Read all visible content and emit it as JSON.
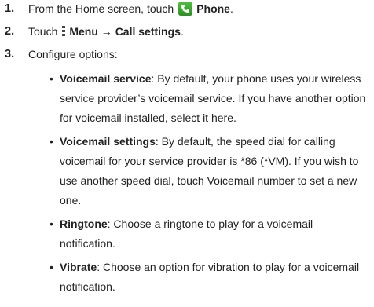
{
  "steps": [
    {
      "number": "1.",
      "before": "From the Home screen, touch",
      "bold": "Phone",
      "after": "."
    },
    {
      "number": "2.",
      "before": "Touch",
      "bold": "Menu → Call settings",
      "after": "."
    },
    {
      "number": "3.",
      "text": "Configure options:"
    }
  ],
  "options": [
    {
      "term": "Voicemail service",
      "description": ": By default, your phone uses your wireless service provider’s voicemail service. If you have another option for voicemail installed, select it here."
    },
    {
      "term": "Voicemail settings",
      "description": ": By default, the speed dial for calling voicemail for your service provider is *86 (*VM). If you wish to use another speed dial, touch Voicemail number to set a new one."
    },
    {
      "term": "Ringtone",
      "description": ": Choose a ringtone to play for a voicemail notification."
    },
    {
      "term": "Vibrate",
      "description": ": Choose an option for vibration to play for a voicemail notification."
    }
  ],
  "bullet_char": "•",
  "icons": {
    "phone": "phone-icon",
    "menu": "menu-icon",
    "phone_icon_color": "#3aa82f"
  }
}
